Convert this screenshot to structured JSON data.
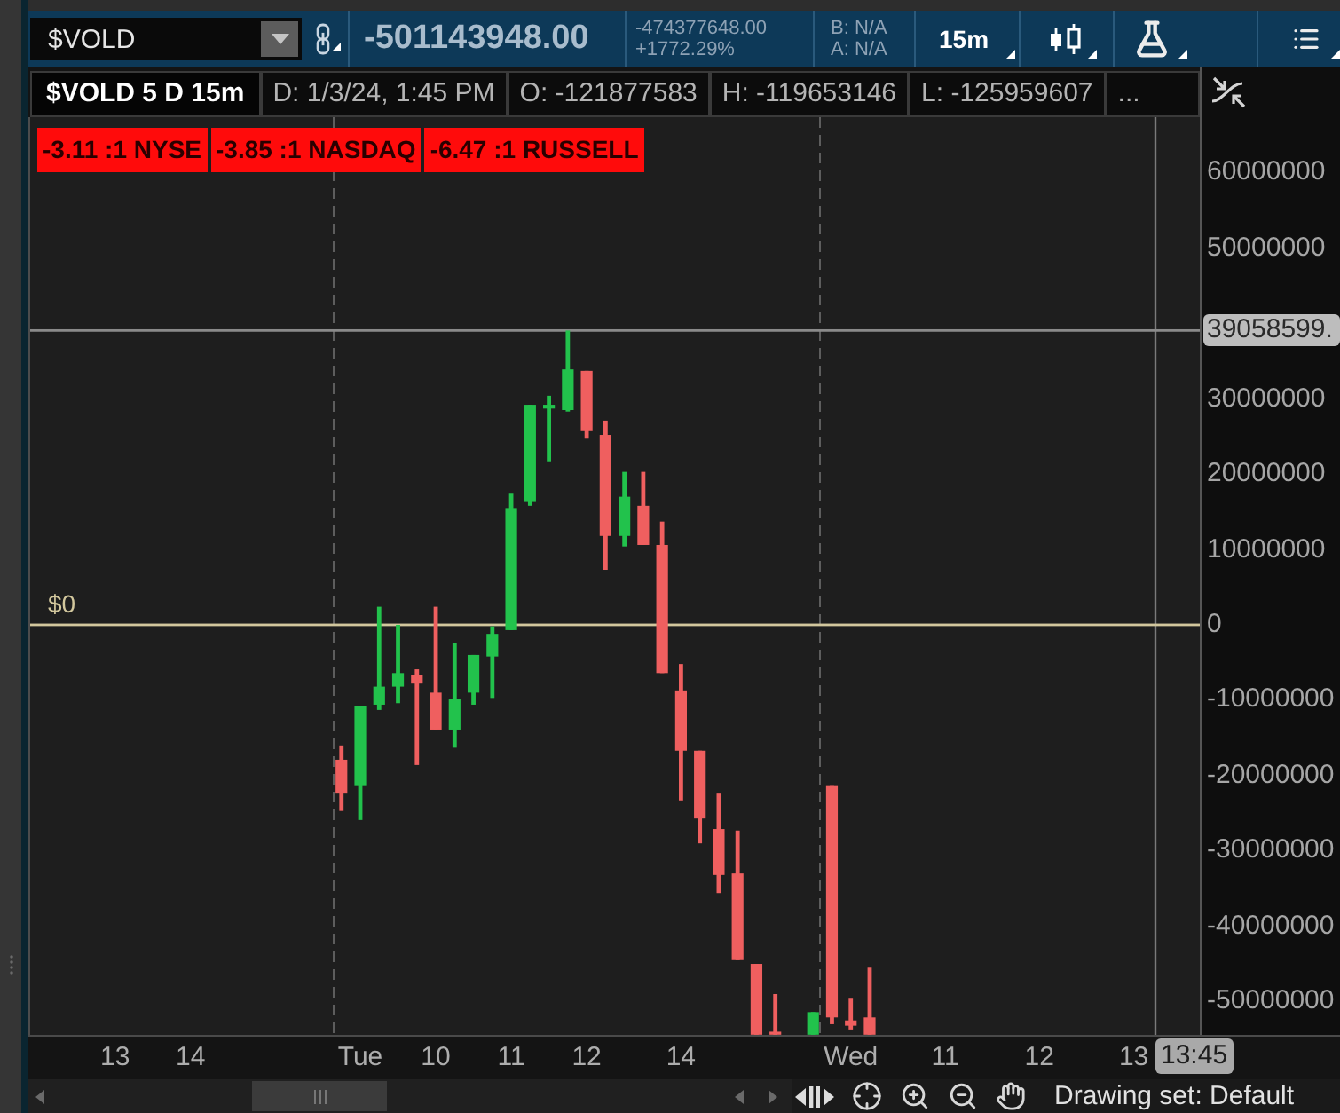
{
  "toolbar": {
    "symbol": "$VOLD",
    "last_price": "-501143948.00",
    "net_change": "-474377648.00",
    "percent_change": "+1772.29%",
    "bid": "B: N/A",
    "ask": "A: N/A",
    "timeframe": "15m"
  },
  "info_bar": {
    "title": "$VOLD 5 D 15m",
    "fields": [
      "D: 1/3/24, 1:45 PM",
      "O: -121877583",
      "H: -119653146",
      "L: -125959607",
      "..."
    ]
  },
  "ratio_labels": [
    "-3.11 :1 NYSE",
    "-3.85 :1 NASDAQ",
    "-6.47 :1 RUSSELL"
  ],
  "chart": {
    "crosshair_price": "39058599.",
    "crosshair_time": "13:45",
    "chart_data": {
      "type": "candlestick",
      "categories": [
        null,
        null,
        null,
        null,
        "13",
        null,
        null,
        null,
        "14",
        null,
        null,
        null,
        null,
        null,
        null,
        null,
        null,
        "Tue",
        null,
        null,
        null,
        "10",
        null,
        null,
        null,
        "11",
        null,
        null,
        null,
        "12",
        null,
        null,
        null,
        null,
        "14",
        null,
        null,
        null,
        null,
        null,
        null,
        null,
        null,
        "Wed",
        null,
        null,
        null,
        null,
        "11",
        null,
        null,
        null,
        null,
        "12",
        null,
        null,
        null,
        null,
        "13",
        null,
        null,
        null
      ],
      "ohlc": [
        null,
        null,
        null,
        null,
        null,
        null,
        null,
        null,
        null,
        null,
        null,
        null,
        null,
        null,
        null,
        null,
        [
          -17900000,
          -16000000,
          -24700000,
          -22400000
        ],
        [
          -21400000,
          -10800000,
          -25900000,
          -10800000
        ],
        [
          -10600000,
          2400000,
          -11300000,
          -8200000
        ],
        [
          -8200000,
          0,
          -10400000,
          -6400000
        ],
        [
          -6600000,
          -5900000,
          -18600000,
          -7800000
        ],
        [
          -9000000,
          2400000,
          -13900000,
          -13900000
        ],
        [
          -13900000,
          -2400000,
          -16300000,
          -9900000
        ],
        [
          -9000000,
          -4000000,
          -10600000,
          -4000000
        ],
        [
          -4200000,
          -200000,
          -9700000,
          -1200000
        ],
        [
          -700000,
          17400000,
          -700000,
          15500000
        ],
        [
          16300000,
          29200000,
          15800000,
          29200000
        ],
        [
          28700000,
          30400000,
          21700000,
          29200000
        ],
        [
          28500000,
          39058599,
          28300000,
          33900000
        ],
        [
          33700000,
          33700000,
          24700000,
          25700000
        ],
        [
          25200000,
          27100000,
          7300000,
          11800000
        ],
        [
          11800000,
          20300000,
          10400000,
          17000000
        ],
        [
          15800000,
          20300000,
          10600000,
          10600000
        ],
        [
          10600000,
          13700000,
          -6400000,
          -6400000
        ],
        [
          -8700000,
          -5200000,
          -23300000,
          -16700000
        ],
        [
          -16700000,
          -16700000,
          -29000000,
          -25700000
        ],
        [
          -27100000,
          -22400000,
          -35600000,
          -33200000
        ],
        [
          -33000000,
          -27300000,
          -44500000,
          -44500000
        ],
        [
          -45000000,
          -45000000,
          -54400000,
          -54400000
        ],
        [
          -54000000,
          -49000000,
          -54400000,
          -54400000
        ],
        null,
        [
          -54400000,
          -51400000,
          -54400000,
          -51400000
        ],
        [
          -21400000,
          -21400000,
          -53000000,
          -52100000
        ],
        [
          -52500000,
          -49500000,
          -53700000,
          -53200000
        ],
        [
          -52100000,
          -45500000,
          -54400000,
          -54400000
        ],
        null,
        null,
        null,
        null,
        null,
        null,
        null,
        null,
        null,
        null,
        null,
        null,
        null,
        null,
        null,
        null,
        null
      ],
      "ylim": [
        -54420000,
        67370000
      ],
      "yticks": [
        -50000000,
        -40000000,
        -30000000,
        -20000000,
        -10000000,
        0,
        10000000,
        20000000,
        30000000,
        50000000,
        60000000
      ],
      "ref_lines": [
        {
          "axis": "y",
          "value": 39058599,
          "color": "#8a8a8a"
        },
        {
          "axis": "y",
          "value": 0,
          "color": "#d2c79d",
          "label": "$0"
        }
      ]
    }
  },
  "status_bar": {
    "drawing_set": "Drawing set: Default"
  }
}
